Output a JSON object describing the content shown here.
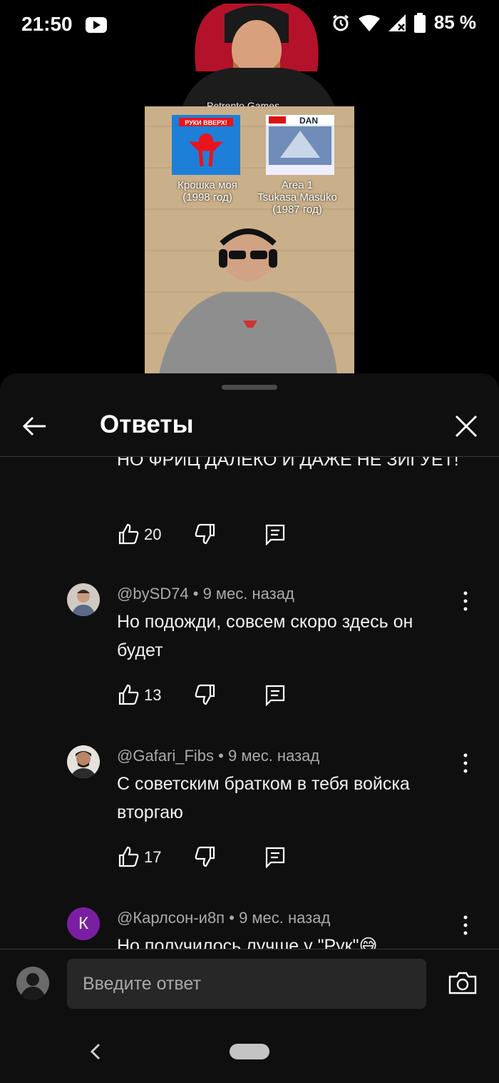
{
  "status_bar": {
    "time": "21:50",
    "battery": "85 %"
  },
  "video": {
    "channel_watermark": "Petrento Games",
    "card1_caption": "Крошка моя\n(1998 год)",
    "card2_caption": "Area 1\nTsukasa Masuko\n(1987 год)",
    "card1_logo_text": "РУКИ ВВЕРХ!",
    "card2_logo_text": "DAN"
  },
  "sheet": {
    "title": "Ответы"
  },
  "replies": [
    {
      "author": "",
      "age": "",
      "text": "НО ФРИЦ ДАЛЕКО И ДАЖЕ НЕ ЗИГУЕТ!",
      "likes": "20"
    },
    {
      "author": "@bySD74",
      "age": "9 мес. назад",
      "text": "Но подожди, совсем скоро здесь он будет",
      "likes": "13"
    },
    {
      "author": "@Gafari_Fibs",
      "age": "9 мес. назад",
      "text": "С советским братком в тебя войска вторгаю",
      "likes": "17"
    },
    {
      "author": "@Карлсон-и8п",
      "age": "9 мес. назад",
      "text": "Но получилось лучше у \"Рук\"😅",
      "likes": "",
      "avatar_letter": "К"
    }
  ],
  "composer": {
    "placeholder": "Введите ответ"
  },
  "colors": {
    "sheet_bg": "#0f0f0f",
    "avatar_purple": "#7b1fa2",
    "meta_text": "#aaaaaa"
  },
  "icons": [
    "youtube-icon",
    "alarm-icon",
    "wifi-icon",
    "signal-icon",
    "battery-icon",
    "back-arrow-icon",
    "close-icon",
    "thumb-up-icon",
    "thumb-down-icon",
    "reply-icon",
    "more-vert-icon",
    "camera-icon"
  ]
}
